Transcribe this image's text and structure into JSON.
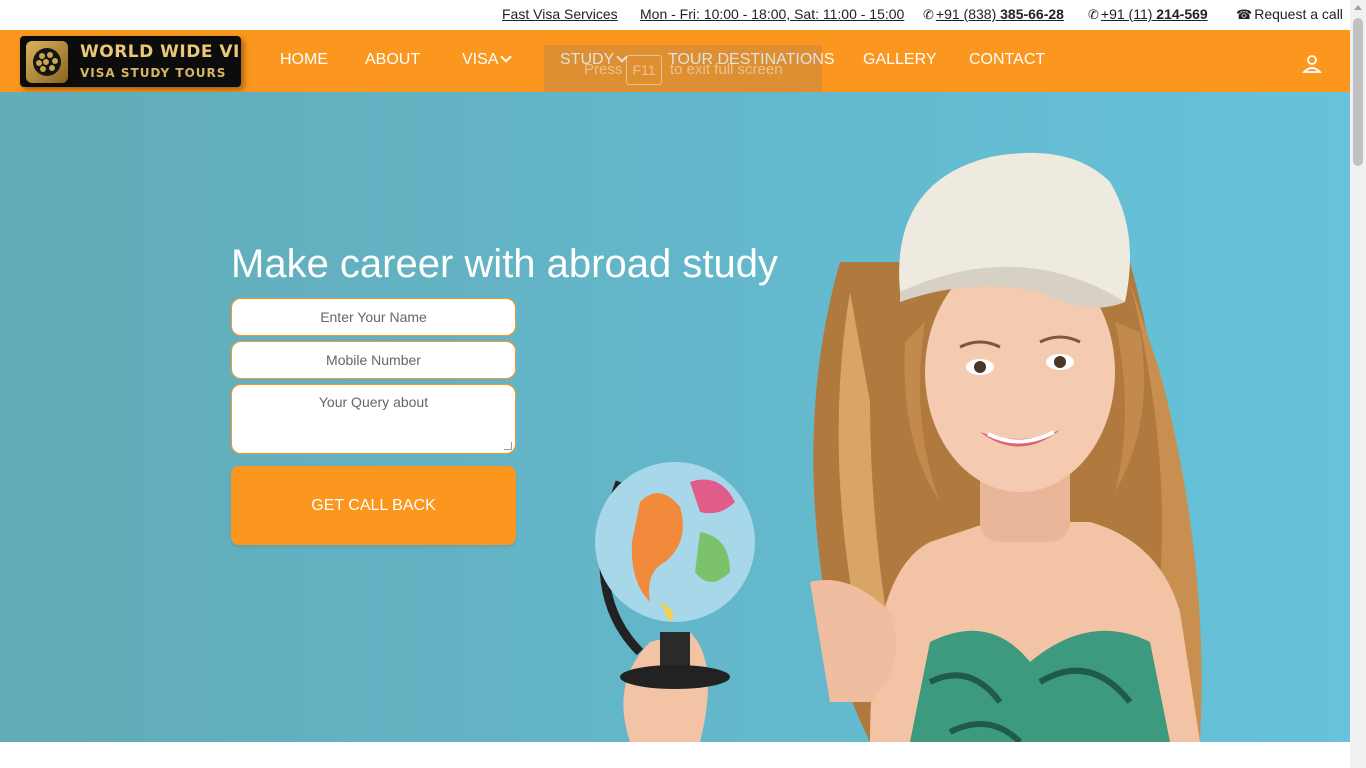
{
  "topbar": {
    "fast_visa": "Fast Visa Services",
    "hours": "Mon - Fri: 10:00 - 18:00, Sat: 11:00 - 15:00",
    "phone1_prefix": "+91 (838) ",
    "phone1_number": "385-66-28",
    "phone2_prefix": "+91 (11) ",
    "phone2_number": "214-569",
    "request_call": "Request a call"
  },
  "logo": {
    "line1": "WORLD WIDE VISA",
    "line2": "VISA STUDY TOURS"
  },
  "nav": {
    "home": "HOME",
    "about": "ABOUT",
    "visa": "VISA",
    "study": "STUDY",
    "tour": "TOUR DESTINATIONS",
    "gallery": "GALLERY",
    "contact": "CONTACT"
  },
  "fullscreen_notice": {
    "press": "Press",
    "key": "F11",
    "rest": "to exit full screen"
  },
  "hero": {
    "title": "Make career with abroad study",
    "name_placeholder": "Enter Your Name",
    "mobile_placeholder": "Mobile Number",
    "query_placeholder": "Your Query about",
    "cta": "GET CALL BACK"
  },
  "colors": {
    "accent": "#fb971f",
    "hero_bg": "#64b8cc",
    "logo_bg": "#0c0c0c",
    "logo_gold": "#e9c877"
  },
  "icons": [
    "phone-icon",
    "phone-icon",
    "phone-book-icon",
    "chevron-down-icon",
    "user-icon"
  ]
}
